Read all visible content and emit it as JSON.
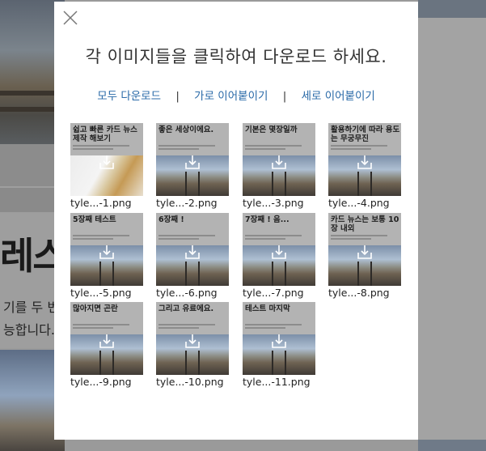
{
  "background": {
    "headline_fragment": "레스",
    "text_line1": "기를 두 번",
    "text_line2": "능합니다."
  },
  "modal": {
    "title": "각 이미지들을 클릭하여 다운로드 하세요.",
    "links": {
      "download_all": "모두 다운로드",
      "join_horizontal": "가로 이어붙이기",
      "join_vertical": "세로 이어붙이기",
      "separator": "|"
    },
    "accent_color": "#2a6aa8",
    "images": [
      {
        "heading": "쉽고 빠른 카드 뉴스 제작 해보기",
        "file": "tyle...-1.png",
        "photo": "food"
      },
      {
        "heading": "좋은 세상이에요.",
        "file": "tyle...-2.png",
        "photo": "railway"
      },
      {
        "heading": "기본은 몇장일까",
        "file": "tyle...-3.png",
        "photo": "railway"
      },
      {
        "heading": "활용하기에 따라 용도는 무궁무진",
        "file": "tyle...-4.png",
        "photo": "railway"
      },
      {
        "heading": "5장째 테스트",
        "file": "tyle...-5.png",
        "photo": "railway"
      },
      {
        "heading": "6장째 !",
        "file": "tyle...-6.png",
        "photo": "railway"
      },
      {
        "heading": "7장째 ! 음...",
        "file": "tyle...-7.png",
        "photo": "railway"
      },
      {
        "heading": "카드 뉴스는 보통 10장 내외",
        "file": "tyle...-8.png",
        "photo": "railway"
      },
      {
        "heading": "많아지면 곤란",
        "file": "tyle...-9.png",
        "photo": "railway"
      },
      {
        "heading": "그리고 유료에요.",
        "file": "tyle...-10.png",
        "photo": "railway"
      },
      {
        "heading": "테스트 마지막",
        "file": "tyle...-11.png",
        "photo": "railway"
      }
    ]
  }
}
